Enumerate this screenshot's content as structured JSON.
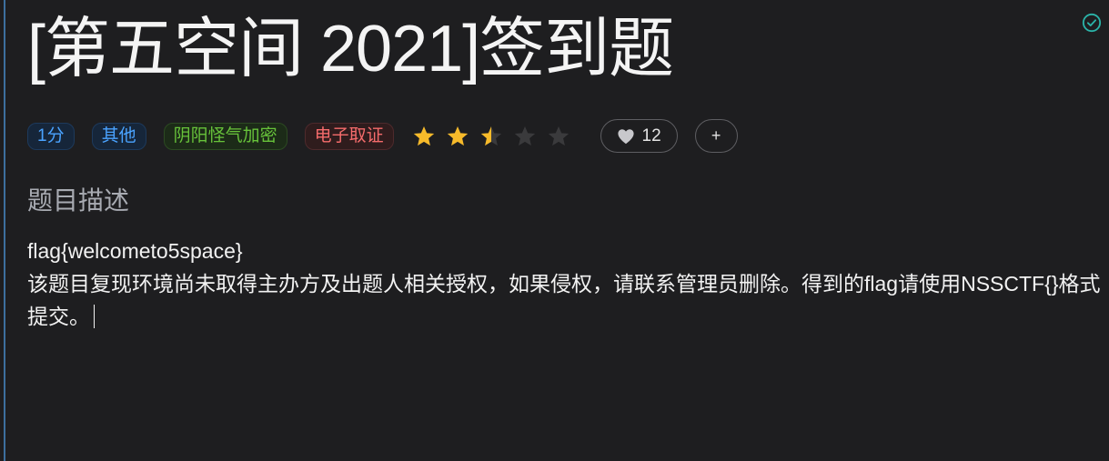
{
  "problem": {
    "title": "[第五空间 2021]签到题",
    "solved": true
  },
  "tags": [
    {
      "label": "1分",
      "color": "blue"
    },
    {
      "label": "其他",
      "color": "blue"
    },
    {
      "label": "阴阳怪气加密",
      "color": "green"
    },
    {
      "label": "电子取证",
      "color": "red"
    }
  ],
  "rating": {
    "value": 2.5,
    "max": 5,
    "star_color": "#f7ba2a",
    "empty_color": "#3a3a3c"
  },
  "likes": {
    "count": "12",
    "icon": "heart-icon"
  },
  "add_button": {
    "label": "+"
  },
  "description": {
    "heading": "题目描述",
    "line1": "flag{welcometo5space}",
    "line2": "该题目复现环境尚未取得主办方及出题人相关授权，如果侵权，请联系管理员删除。得到的flag请使用NSSCTF{}格式提交。"
  }
}
